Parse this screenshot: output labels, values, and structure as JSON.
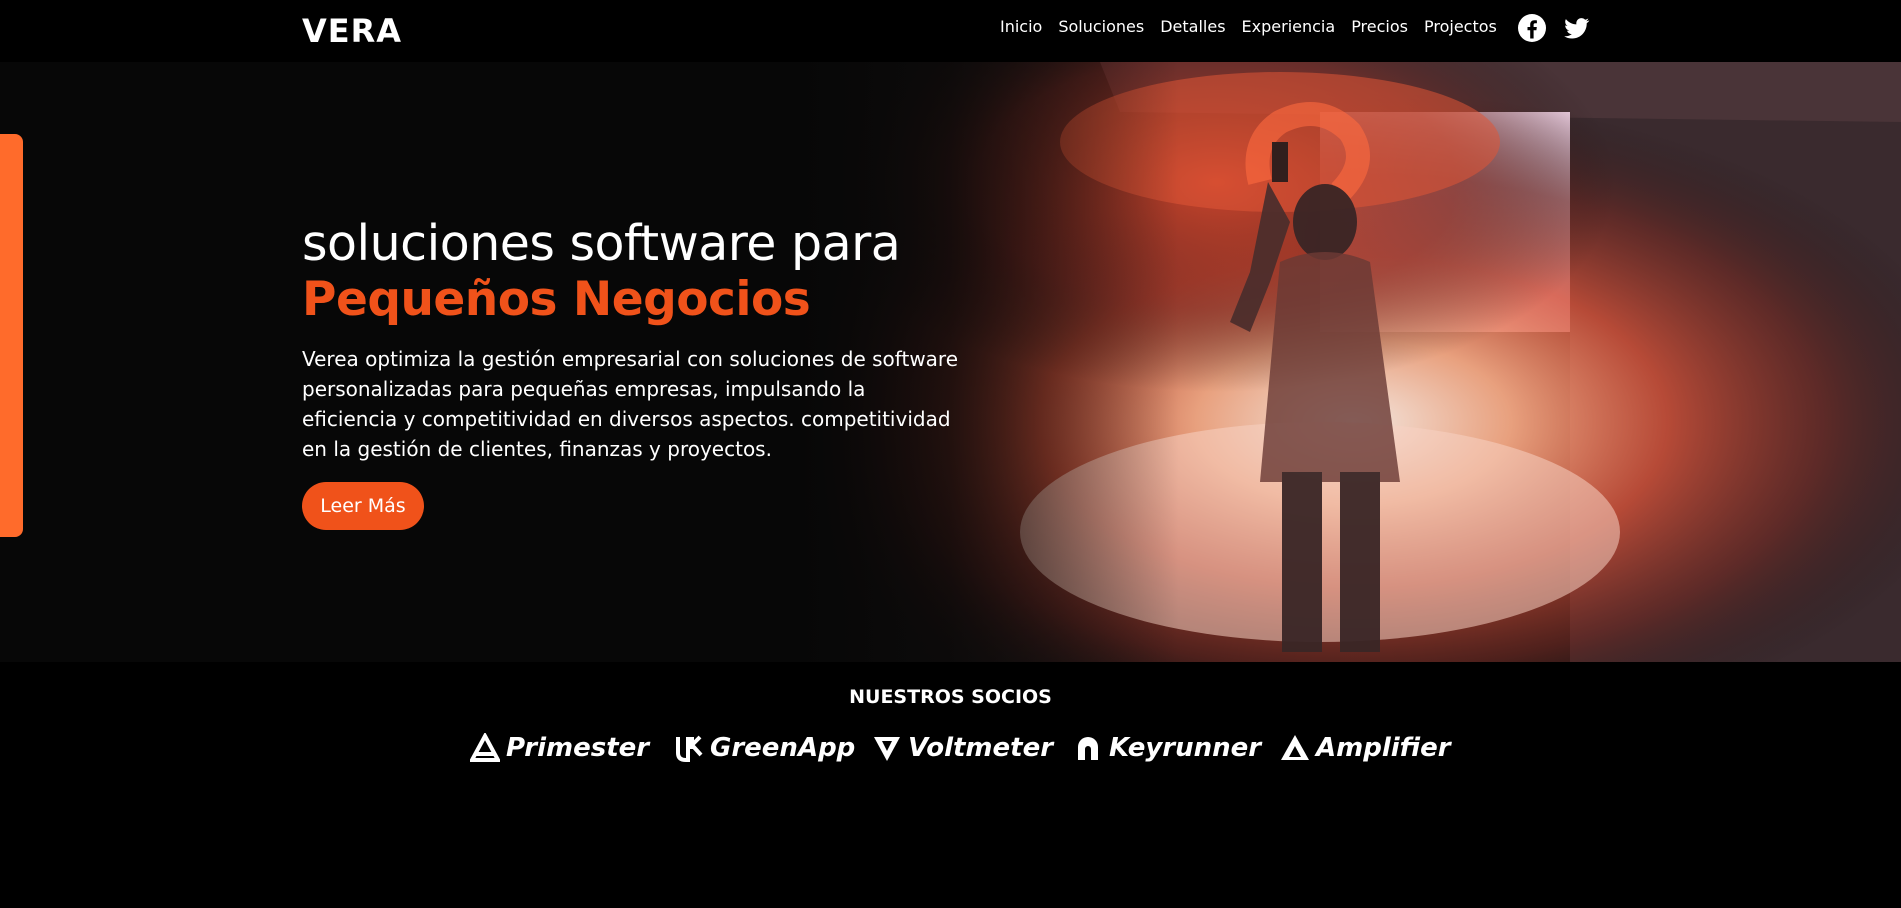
{
  "brand": {
    "logo_text": "VERA"
  },
  "nav": {
    "links": [
      "Inicio",
      "Soluciones",
      "Detalles",
      "Experiencia",
      "Precios",
      "Projectos"
    ],
    "social": {
      "facebook_icon": "facebook-icon",
      "twitter_icon": "twitter-icon"
    }
  },
  "hero": {
    "title": "soluciones software para",
    "highlight": "Pequeños Negocios",
    "description": "Verea optimiza la gestión empresarial con soluciones de software personalizadas para pequeñas empresas, impulsando la eficiencia y competitividad en diversos aspectos. competitividad en la gestión de clientes, finanzas y proyectos.",
    "cta_label": "Leer Más"
  },
  "partners": {
    "title": "NUESTROS SOCIOS",
    "items": [
      "Primester",
      "GreenApp",
      "Voltmeter",
      "Keyrunner",
      "Amplifier"
    ]
  },
  "colors": {
    "accent": "#f0521a",
    "side_accent": "#ff6b2b",
    "background": "#000000"
  }
}
